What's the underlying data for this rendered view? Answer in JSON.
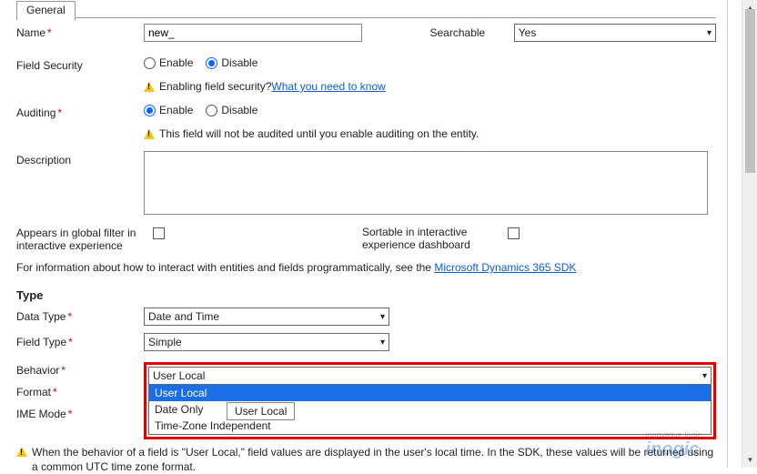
{
  "tab": {
    "general": "General"
  },
  "name": {
    "label": "Name",
    "value": "new_",
    "searchable_label": "Searchable",
    "searchable_value": "Yes"
  },
  "field_security": {
    "label": "Field Security",
    "enable": "Enable",
    "disable": "Disable",
    "selected": "disable",
    "info_prefix": "Enabling field security? ",
    "info_link": "What you need to know"
  },
  "auditing": {
    "label": "Auditing",
    "enable": "Enable",
    "disable": "Disable",
    "selected": "enable",
    "info": "This field will not be audited until you enable auditing on the entity."
  },
  "description": {
    "label": "Description",
    "value": ""
  },
  "global_filter": {
    "label": "Appears in global filter in interactive experience",
    "checked": false
  },
  "sortable": {
    "label": "Sortable in interactive experience dashboard",
    "checked": false
  },
  "sdk": {
    "prefix": "For information about how to interact with entities and fields programmatically, see the ",
    "link": "Microsoft Dynamics 365 SDK"
  },
  "type_section": {
    "heading": "Type",
    "data_type": {
      "label": "Data Type",
      "value": "Date and Time"
    },
    "field_type": {
      "label": "Field Type",
      "value": "Simple"
    },
    "behavior": {
      "label": "Behavior",
      "value": "User Local",
      "options": [
        "User Local",
        "Date Only",
        "Time-Zone Independent"
      ],
      "tooltip": "User Local"
    },
    "format": {
      "label": "Format"
    },
    "ime_mode": {
      "label": "IME Mode"
    }
  },
  "footnote": "When the behavior of a field is \"User Local,\" field values are displayed in the user's local time. In the SDK, these values will be returned using a common UTC time zone format.",
  "watermark_top": "innovative logic",
  "watermark": "inogic"
}
